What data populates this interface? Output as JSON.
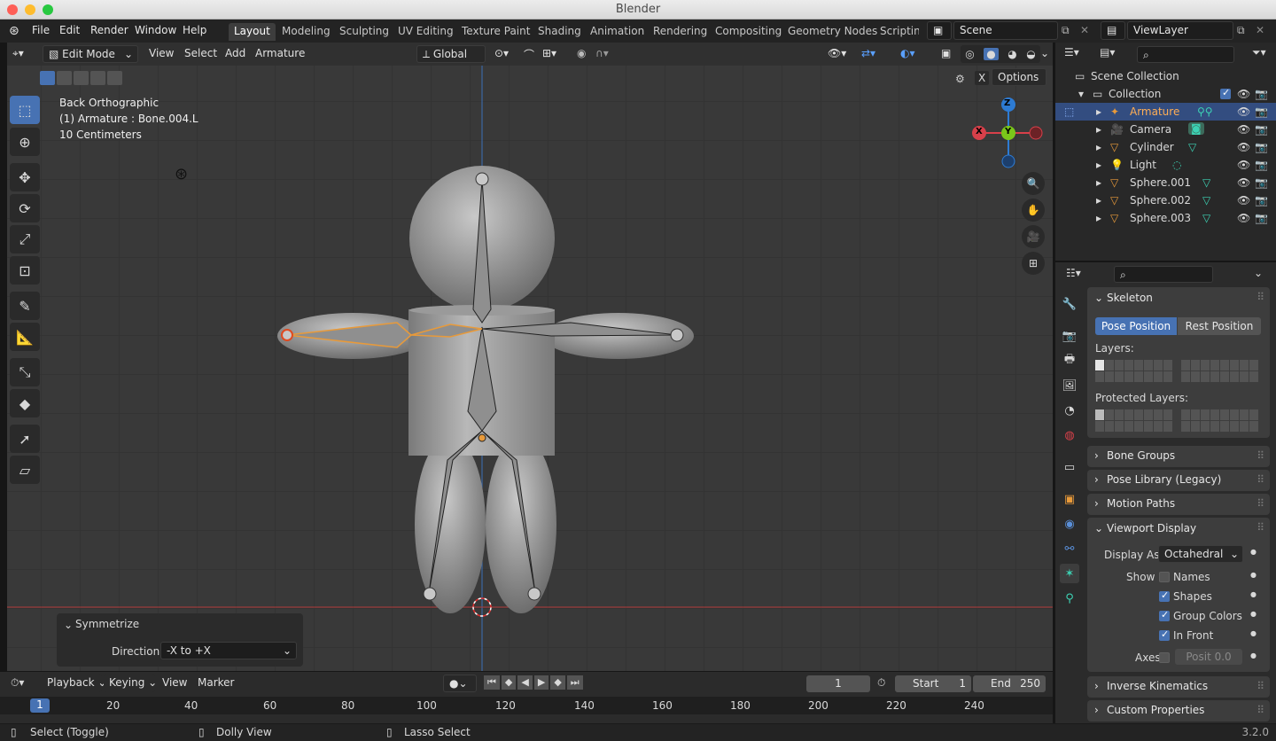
{
  "window": {
    "title": "Blender"
  },
  "menu": [
    "File",
    "Edit",
    "Render",
    "Window",
    "Help"
  ],
  "workspaces": [
    "Layout",
    "Modeling",
    "Sculpting",
    "UV Editing",
    "Texture Paint",
    "Shading",
    "Animation",
    "Rendering",
    "Compositing",
    "Geometry Nodes",
    "Scripting"
  ],
  "scene": {
    "name": "Scene",
    "view_layer": "ViewLayer"
  },
  "viewport_header": {
    "mode": "Edit Mode",
    "menus": [
      "View",
      "Select",
      "Add",
      "Armature"
    ],
    "orientation": "Global",
    "options": "Options"
  },
  "viewport_info": {
    "view": "Back Orthographic",
    "object": "(1) Armature : Bone.004.L",
    "scale": "10 Centimeters"
  },
  "gizmo": {
    "z": "Z",
    "y": "Y",
    "x": "X"
  },
  "operator_panel": {
    "title": "Symmetrize",
    "direction_label": "Direction",
    "direction_value": "-X to +X"
  },
  "timeline": {
    "menus": [
      "Playback",
      "Keying",
      "View",
      "Marker"
    ],
    "current_frame": "1",
    "start_label": "Start",
    "start": "1",
    "end_label": "End",
    "end": "250",
    "ticks": [
      "1",
      "20",
      "40",
      "60",
      "80",
      "100",
      "120",
      "140",
      "160",
      "180",
      "200",
      "220",
      "240"
    ]
  },
  "status": {
    "left": "Select (Toggle)",
    "middle": "Dolly View",
    "right": "Lasso Select",
    "version": "3.2.0"
  },
  "outliner": {
    "root": "Scene Collection",
    "collection": "Collection",
    "items": [
      "Armature",
      "Camera",
      "Cylinder",
      "Light",
      "Sphere.001",
      "Sphere.002",
      "Sphere.003"
    ]
  },
  "properties": {
    "skeleton": "Skeleton",
    "pose_position": "Pose Position",
    "rest_position": "Rest Position",
    "layers": "Layers:",
    "protected_layers": "Protected Layers:",
    "collapsed": [
      "Bone Groups",
      "Pose Library (Legacy)",
      "Motion Paths"
    ],
    "viewport_display": "Viewport Display",
    "display_as_label": "Display As",
    "display_as": "Octahedral",
    "show_label": "Show",
    "show": [
      {
        "label": "Names",
        "checked": false
      },
      {
        "label": "Shapes",
        "checked": true
      },
      {
        "label": "Group Colors",
        "checked": true
      },
      {
        "label": "In Front",
        "checked": true
      }
    ],
    "axes_label": "Axes",
    "axes_value": "Posit  0.0",
    "more": [
      "Inverse Kinematics",
      "Custom Properties"
    ]
  },
  "colors": {
    "accent": "#4772b3",
    "selected_bone": "#e89a3a",
    "x_axis": "#d8404a",
    "y_axis": "#7ac71a",
    "z_axis": "#2d7bd3"
  }
}
